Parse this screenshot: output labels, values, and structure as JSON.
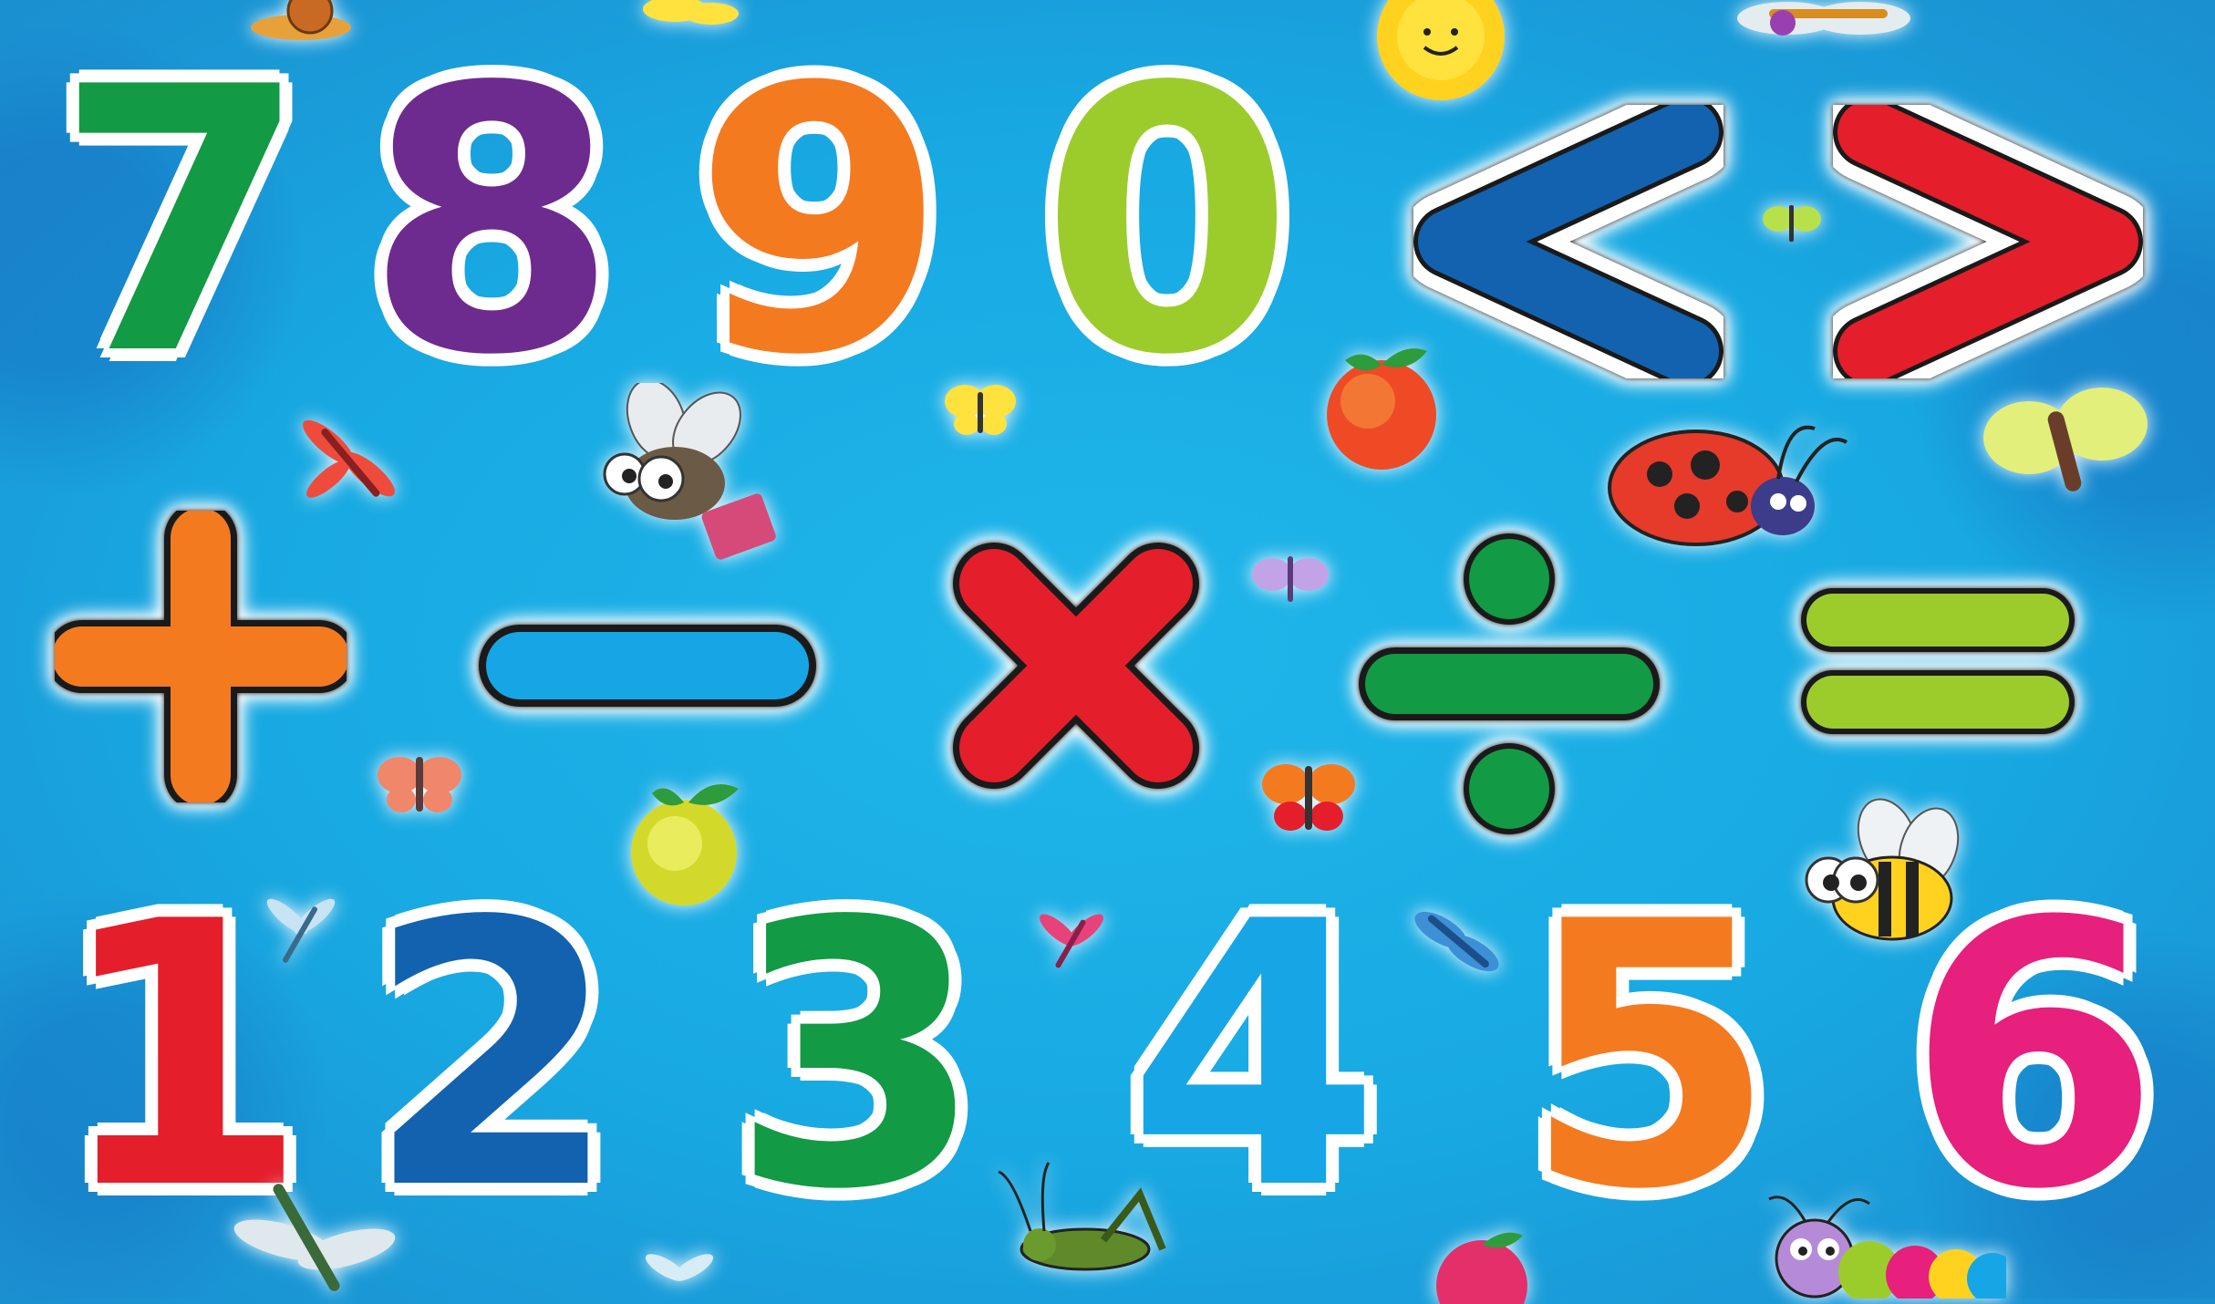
{
  "row_top": [
    "7",
    "8",
    "9",
    "0"
  ],
  "row_bottom": [
    "1",
    "2",
    "3",
    "4",
    "5",
    "6"
  ],
  "symbols": [
    "<",
    ">",
    "+",
    "−",
    "×",
    "÷",
    "="
  ],
  "colors": {
    "background": "#18a9e2",
    "green": "#129a45",
    "purple": "#6d2b8f",
    "orange": "#f47a20",
    "lime": "#9ccc2c",
    "blue_dark": "#1262b0",
    "red": "#e41e2b",
    "blue_light": "#16a6e5",
    "magenta": "#e6207c",
    "outline": "#1a1a1a",
    "border": "#ffffff"
  },
  "decorations": [
    "sun-icon",
    "apple-icon",
    "butterfly-icon",
    "dragonfly-icon",
    "ladybug-icon",
    "fly-icon",
    "bee-icon",
    "grasshopper-icon",
    "caterpillar-icon",
    "snail-icon"
  ]
}
